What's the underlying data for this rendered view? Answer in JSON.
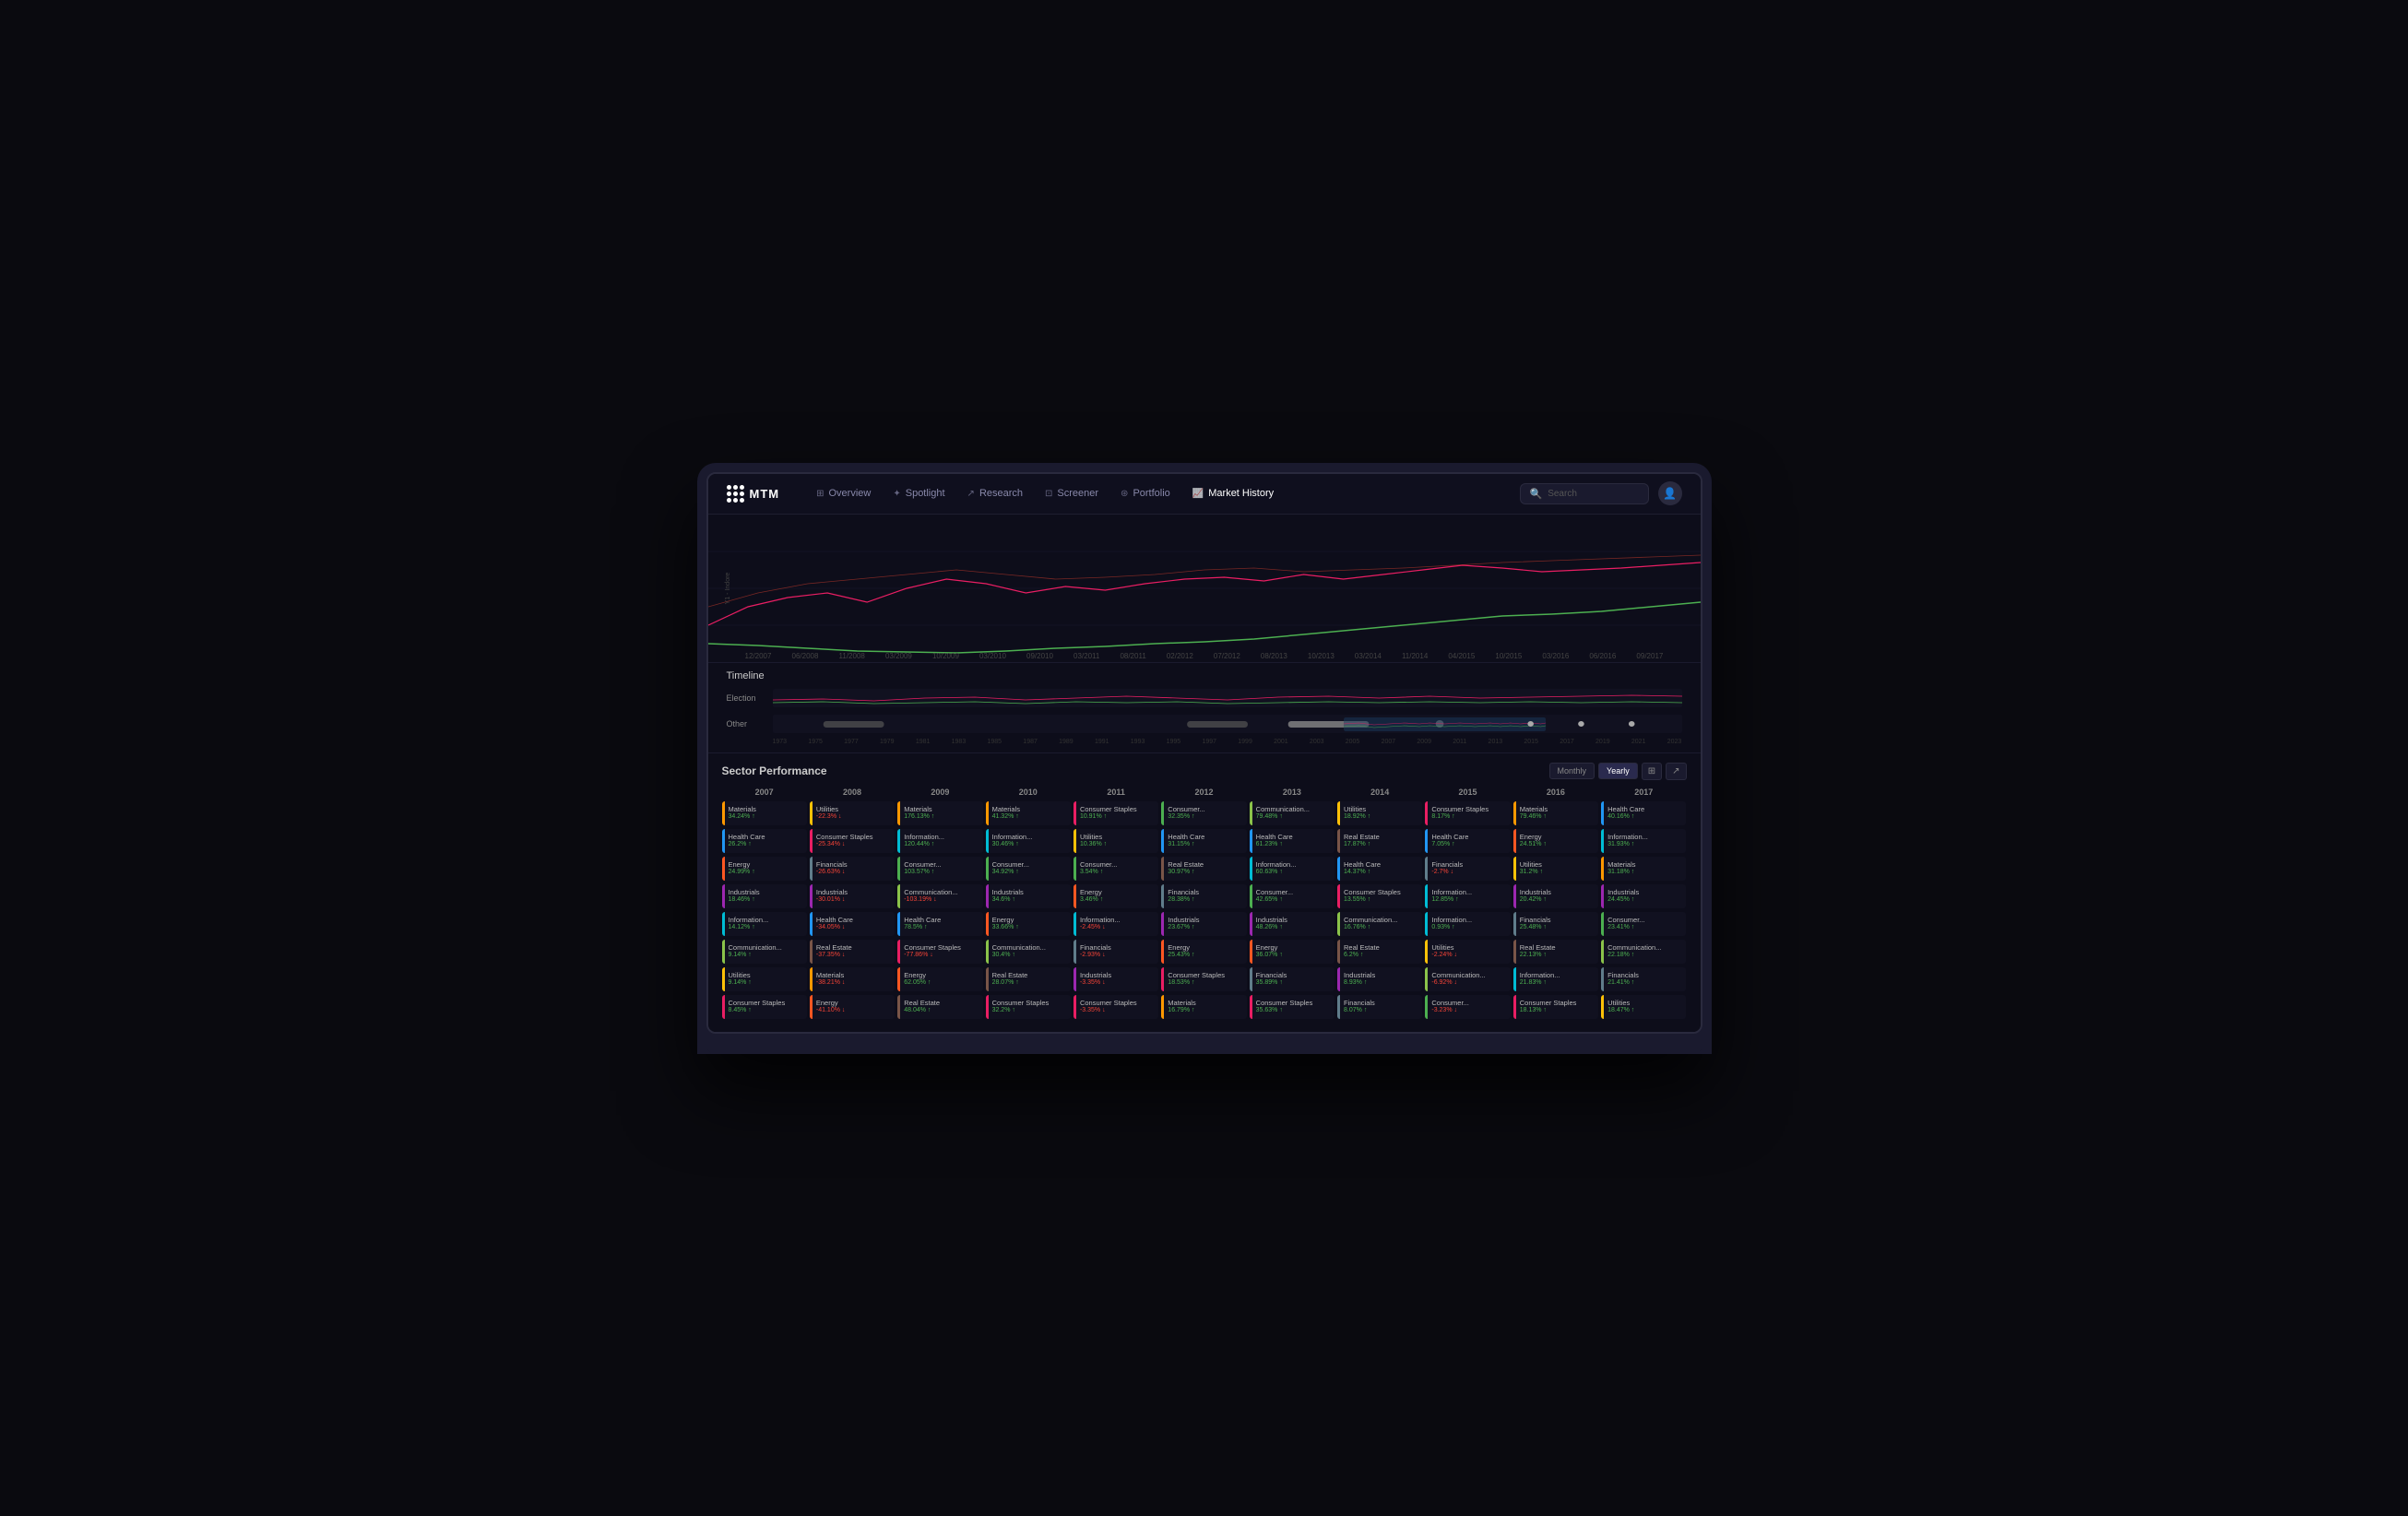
{
  "nav": {
    "logo": "MTM",
    "items": [
      {
        "label": "Overview",
        "icon": "⊞",
        "active": false
      },
      {
        "label": "Spotlight",
        "icon": "✦",
        "active": false
      },
      {
        "label": "Research",
        "icon": "↗",
        "active": false
      },
      {
        "label": "Screener",
        "icon": "⊡",
        "active": false
      },
      {
        "label": "Portfolio",
        "icon": "⊛",
        "active": false
      },
      {
        "label": "Market History",
        "icon": "📈",
        "active": true
      }
    ],
    "search_placeholder": "Search",
    "avatar_icon": "👤"
  },
  "chart": {
    "y_label": "Y1 - Indore",
    "x_labels": [
      "12/2007",
      "06/2008",
      "11/2008",
      "03/2009",
      "10/2009",
      "03/2010",
      "09/2010",
      "03/2011",
      "08/2011",
      "02/2012",
      "07/2012",
      "08/2013",
      "10/2013",
      "03/2014",
      "11/2014",
      "04/2015",
      "10/2015",
      "03/2016",
      "06/2016",
      "09/2017"
    ]
  },
  "timeline": {
    "title": "Timeline",
    "rows": [
      {
        "label": "Election"
      },
      {
        "label": "Other"
      }
    ],
    "x_labels": [
      "1973",
      "1975",
      "1977",
      "1979",
      "1981",
      "1983",
      "1985",
      "1987",
      "1989",
      "1991",
      "1993",
      "1995",
      "1997",
      "1999",
      "2001",
      "2003",
      "2005",
      "2007",
      "2009",
      "2011",
      "2013",
      "2015",
      "2017",
      "2019",
      "2021",
      "2023"
    ]
  },
  "sector": {
    "title": "Sector Performance",
    "controls": {
      "monthly": "Monthly",
      "yearly": "Yearly",
      "active": "Yearly"
    },
    "years": [
      "2007",
      "2008",
      "2009",
      "2010",
      "2011",
      "2012",
      "2013",
      "2014",
      "2015",
      "2016",
      "2017"
    ],
    "columns": {
      "2007": [
        {
          "name": "Materials",
          "value": "34.24%",
          "positive": true,
          "color": "#ff9800"
        },
        {
          "name": "Health Care",
          "value": "26.2%",
          "positive": true,
          "color": "#2196F3"
        },
        {
          "name": "Energy",
          "value": "24.99%",
          "positive": true,
          "color": "#ff5722"
        },
        {
          "name": "Industrials",
          "value": "18.46%",
          "positive": true,
          "color": "#9C27B0"
        },
        {
          "name": "Information...",
          "value": "14.12%",
          "positive": true,
          "color": "#00BCD4"
        },
        {
          "name": "Communication...",
          "value": "9.14%",
          "positive": true,
          "color": "#8BC34A"
        },
        {
          "name": "Utilities",
          "value": "9.14%",
          "positive": true,
          "color": "#FFC107"
        },
        {
          "name": "Consumer Staples",
          "value": "8.45%",
          "positive": true,
          "color": "#E91E63"
        }
      ],
      "2008": [
        {
          "name": "Utilities",
          "value": "-22.3%",
          "positive": false,
          "color": "#FFC107"
        },
        {
          "name": "Consumer Staples",
          "value": "-25.34%",
          "positive": false,
          "color": "#E91E63"
        },
        {
          "name": "Financials",
          "value": "-26.63%",
          "positive": false,
          "color": "#607D8B"
        },
        {
          "name": "Industrials",
          "value": "-30.01%",
          "positive": false,
          "color": "#9C27B0"
        },
        {
          "name": "Health Care",
          "value": "-34.05%",
          "positive": false,
          "color": "#2196F3"
        },
        {
          "name": "Real Estate",
          "value": "-37.35%",
          "positive": false,
          "color": "#795548"
        },
        {
          "name": "Materials",
          "value": "-38.21%",
          "positive": false,
          "color": "#ff9800"
        },
        {
          "name": "Energy",
          "value": "-41.10%",
          "positive": false,
          "color": "#ff5722"
        }
      ],
      "2009": [
        {
          "name": "Materials",
          "value": "176.13%",
          "positive": true,
          "color": "#ff9800"
        },
        {
          "name": "Information...",
          "value": "120.44%",
          "positive": true,
          "color": "#00BCD4"
        },
        {
          "name": "Consumer...",
          "value": "103.57%",
          "positive": true,
          "color": "#4CAF50"
        },
        {
          "name": "Communication...",
          "value": "-103.19%",
          "positive": false,
          "color": "#8BC34A"
        },
        {
          "name": "Health Care",
          "value": "78.5%",
          "positive": true,
          "color": "#2196F3"
        },
        {
          "name": "Consumer Staples",
          "value": "-77.86%",
          "positive": false,
          "color": "#E91E63"
        },
        {
          "name": "Energy",
          "value": "62.05%",
          "positive": true,
          "color": "#ff5722"
        },
        {
          "name": "Real Estate",
          "value": "48.04%",
          "positive": true,
          "color": "#795548"
        }
      ],
      "2010": [
        {
          "name": "Materials",
          "value": "41.32%",
          "positive": true,
          "color": "#ff9800"
        },
        {
          "name": "Information...",
          "value": "30.46%",
          "positive": true,
          "color": "#00BCD4"
        },
        {
          "name": "Consumer...",
          "value": "34.92%",
          "positive": true,
          "color": "#4CAF50"
        },
        {
          "name": "Industrials",
          "value": "34.6%",
          "positive": true,
          "color": "#9C27B0"
        },
        {
          "name": "Energy",
          "value": "33.66%",
          "positive": true,
          "color": "#ff5722"
        },
        {
          "name": "Communication...",
          "value": "30.4%",
          "positive": true,
          "color": "#8BC34A"
        },
        {
          "name": "Real Estate",
          "value": "28.07%",
          "positive": true,
          "color": "#795548"
        },
        {
          "name": "Consumer Staples",
          "value": "32.2%",
          "positive": true,
          "color": "#E91E63"
        }
      ],
      "2011": [
        {
          "name": "Consumer Staples",
          "value": "10.91%",
          "positive": true,
          "color": "#E91E63"
        },
        {
          "name": "Utilities",
          "value": "10.36%",
          "positive": true,
          "color": "#FFC107"
        },
        {
          "name": "Consumer...",
          "value": "3.54%",
          "positive": true,
          "color": "#4CAF50"
        },
        {
          "name": "Energy",
          "value": "3.46%",
          "positive": true,
          "color": "#ff5722"
        },
        {
          "name": "Information...",
          "value": "-2.45%",
          "positive": false,
          "color": "#00BCD4"
        },
        {
          "name": "Financials",
          "value": "-2.93%",
          "positive": false,
          "color": "#607D8B"
        },
        {
          "name": "Industrials",
          "value": "-3.35%",
          "positive": false,
          "color": "#9C27B0"
        },
        {
          "name": "Consumer Staples",
          "value": "-3.35%",
          "positive": false,
          "color": "#E91E63"
        }
      ],
      "2012": [
        {
          "name": "Consumer...",
          "value": "32.35%",
          "positive": true,
          "color": "#4CAF50"
        },
        {
          "name": "Health Care",
          "value": "31.15%",
          "positive": true,
          "color": "#2196F3"
        },
        {
          "name": "Real Estate",
          "value": "30.97%",
          "positive": true,
          "color": "#795548"
        },
        {
          "name": "Financials",
          "value": "28.38%",
          "positive": true,
          "color": "#607D8B"
        },
        {
          "name": "Industrials",
          "value": "23.67%",
          "positive": true,
          "color": "#9C27B0"
        },
        {
          "name": "Energy",
          "value": "25.43%",
          "positive": true,
          "color": "#ff5722"
        },
        {
          "name": "Consumer Staples",
          "value": "18.53%",
          "positive": true,
          "color": "#E91E63"
        },
        {
          "name": "Materials",
          "value": "16.79%",
          "positive": true,
          "color": "#ff9800"
        }
      ],
      "2013": [
        {
          "name": "Communication...",
          "value": "79.48%",
          "positive": true,
          "color": "#8BC34A"
        },
        {
          "name": "Health Care",
          "value": "61.23%",
          "positive": true,
          "color": "#2196F3"
        },
        {
          "name": "Information...",
          "value": "60.63%",
          "positive": true,
          "color": "#00BCD4"
        },
        {
          "name": "Consumer...",
          "value": "42.65%",
          "positive": true,
          "color": "#4CAF50"
        },
        {
          "name": "Industrials",
          "value": "48.26%",
          "positive": true,
          "color": "#9C27B0"
        },
        {
          "name": "Energy",
          "value": "36.07%",
          "positive": true,
          "color": "#ff5722"
        },
        {
          "name": "Financials",
          "value": "35.89%",
          "positive": true,
          "color": "#607D8B"
        },
        {
          "name": "Consumer Staples",
          "value": "35.63%",
          "positive": true,
          "color": "#E91E63"
        }
      ],
      "2014": [
        {
          "name": "Utilities",
          "value": "18.92%",
          "positive": true,
          "color": "#FFC107"
        },
        {
          "name": "Real Estate",
          "value": "17.87%",
          "positive": true,
          "color": "#795548"
        },
        {
          "name": "Health Care",
          "value": "14.37%",
          "positive": true,
          "color": "#2196F3"
        },
        {
          "name": "Consumer Staples",
          "value": "13.55%",
          "positive": true,
          "color": "#E91E63"
        },
        {
          "name": "Communication...",
          "value": "16.76%",
          "positive": true,
          "color": "#8BC34A"
        },
        {
          "name": "Real Estate",
          "value": "6.2%",
          "positive": true,
          "color": "#795548"
        },
        {
          "name": "Industrials",
          "value": "8.93%",
          "positive": true,
          "color": "#9C27B0"
        },
        {
          "name": "Financials",
          "value": "8.07%",
          "positive": true,
          "color": "#607D8B"
        }
      ],
      "2015": [
        {
          "name": "Consumer Staples",
          "value": "8.17%",
          "positive": true,
          "color": "#E91E63"
        },
        {
          "name": "Health Care",
          "value": "7.05%",
          "positive": true,
          "color": "#2196F3"
        },
        {
          "name": "Financials",
          "value": "-2.7%",
          "positive": false,
          "color": "#607D8B"
        },
        {
          "name": "Information...",
          "value": "12.85%",
          "positive": true,
          "color": "#00BCD4"
        },
        {
          "name": "Information...",
          "value": "0.93%",
          "positive": true,
          "color": "#00BCD4"
        },
        {
          "name": "Utilities",
          "value": "-2.24%",
          "positive": false,
          "color": "#FFC107"
        },
        {
          "name": "Communication...",
          "value": "-6.92%",
          "positive": false,
          "color": "#8BC34A"
        },
        {
          "name": "Consumer...",
          "value": "-3.23%",
          "positive": false,
          "color": "#4CAF50"
        }
      ],
      "2016": [
        {
          "name": "Materials",
          "value": "79.46%",
          "positive": true,
          "color": "#ff9800"
        },
        {
          "name": "Energy",
          "value": "24.51%",
          "positive": true,
          "color": "#ff5722"
        },
        {
          "name": "Utilities",
          "value": "31.2%",
          "positive": true,
          "color": "#FFC107"
        },
        {
          "name": "Industrials",
          "value": "20.42%",
          "positive": true,
          "color": "#9C27B0"
        },
        {
          "name": "Financials",
          "value": "25.48%",
          "positive": true,
          "color": "#607D8B"
        },
        {
          "name": "Real Estate",
          "value": "22.13%",
          "positive": true,
          "color": "#795548"
        },
        {
          "name": "Information...",
          "value": "21.83%",
          "positive": true,
          "color": "#00BCD4"
        },
        {
          "name": "Consumer Staples",
          "value": "18.13%",
          "positive": true,
          "color": "#E91E63"
        }
      ],
      "2017": [
        {
          "name": "Health Care",
          "value": "40.16%",
          "positive": true,
          "color": "#2196F3"
        },
        {
          "name": "Information...",
          "value": "31.93%",
          "positive": true,
          "color": "#00BCD4"
        },
        {
          "name": "Materials",
          "value": "31.18%",
          "positive": true,
          "color": "#ff9800"
        },
        {
          "name": "Industrials",
          "value": "24.45%",
          "positive": true,
          "color": "#9C27B0"
        },
        {
          "name": "Consumer...",
          "value": "23.41%",
          "positive": true,
          "color": "#4CAF50"
        },
        {
          "name": "Communication...",
          "value": "22.18%",
          "positive": true,
          "color": "#8BC34A"
        },
        {
          "name": "Financials",
          "value": "21.41%",
          "positive": true,
          "color": "#607D8B"
        },
        {
          "name": "Utilities",
          "value": "18.47%",
          "positive": true,
          "color": "#FFC107"
        }
      ]
    }
  }
}
